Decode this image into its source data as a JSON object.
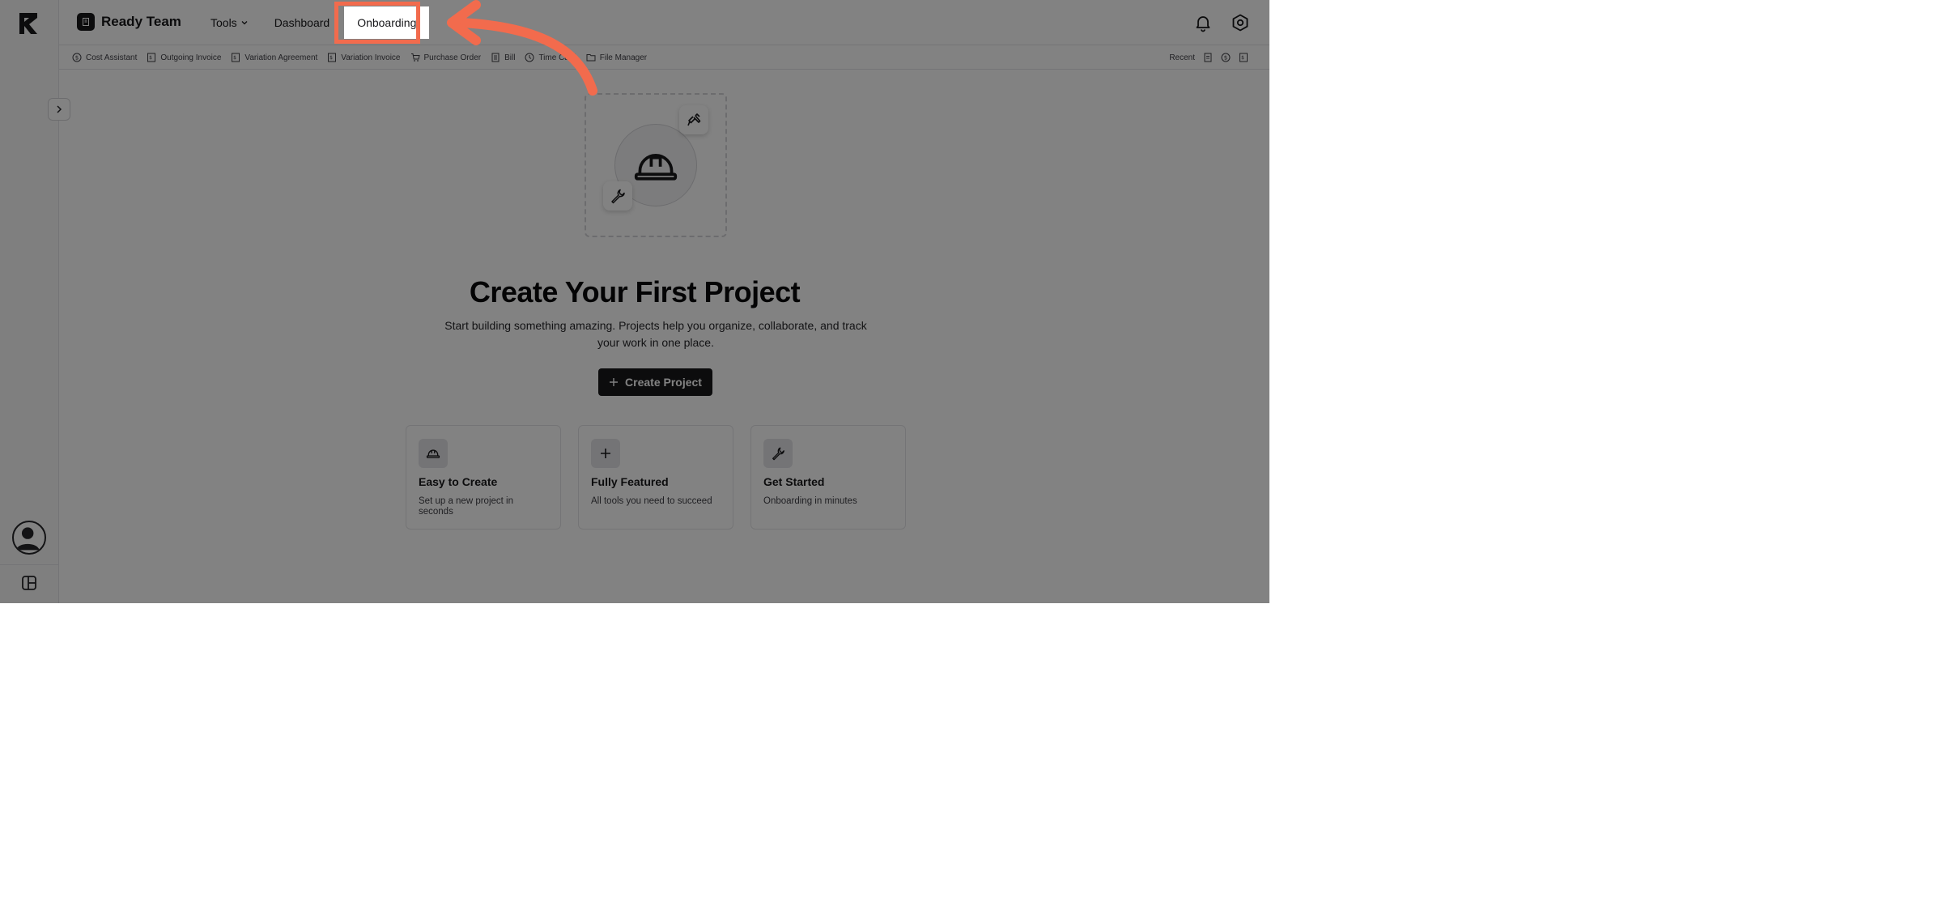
{
  "header": {
    "brand_name": "Ready Team",
    "nav": [
      {
        "label": "Tools"
      },
      {
        "label": "Dashboard"
      },
      {
        "label": "Onboarding"
      }
    ]
  },
  "quick_links": [
    {
      "label": "Cost Assistant",
      "icon": "dollar-circle-icon"
    },
    {
      "label": "Outgoing Invoice",
      "icon": "invoice-icon"
    },
    {
      "label": "Variation Agreement",
      "icon": "invoice-icon"
    },
    {
      "label": "Variation Invoice",
      "icon": "invoice-icon"
    },
    {
      "label": "Purchase Order",
      "icon": "cart-icon"
    },
    {
      "label": "Bill",
      "icon": "receipt-icon"
    },
    {
      "label": "Time Card",
      "icon": "clock-icon"
    },
    {
      "label": "File Manager",
      "icon": "folder-icon"
    }
  ],
  "recent": {
    "label": "Recent"
  },
  "main": {
    "title": "Create Your First Project",
    "subtitle": "Start building something amazing. Projects help you organize, collaborate, and track your work in one place.",
    "create_button": "Create Project"
  },
  "cards": [
    {
      "title": "Easy to Create",
      "desc": "Set up a new project in seconds",
      "icon": "hard-hat-icon"
    },
    {
      "title": "Fully Featured",
      "desc": "All tools you need to succeed",
      "icon": "plus-icon"
    },
    {
      "title": "Get Started",
      "desc": "Onboarding in minutes",
      "icon": "wrench-icon"
    }
  ],
  "colors": {
    "accent": "#f26b4d",
    "primary_button": "#18181b",
    "overlay": "rgba(0,0,0,0.49)"
  }
}
